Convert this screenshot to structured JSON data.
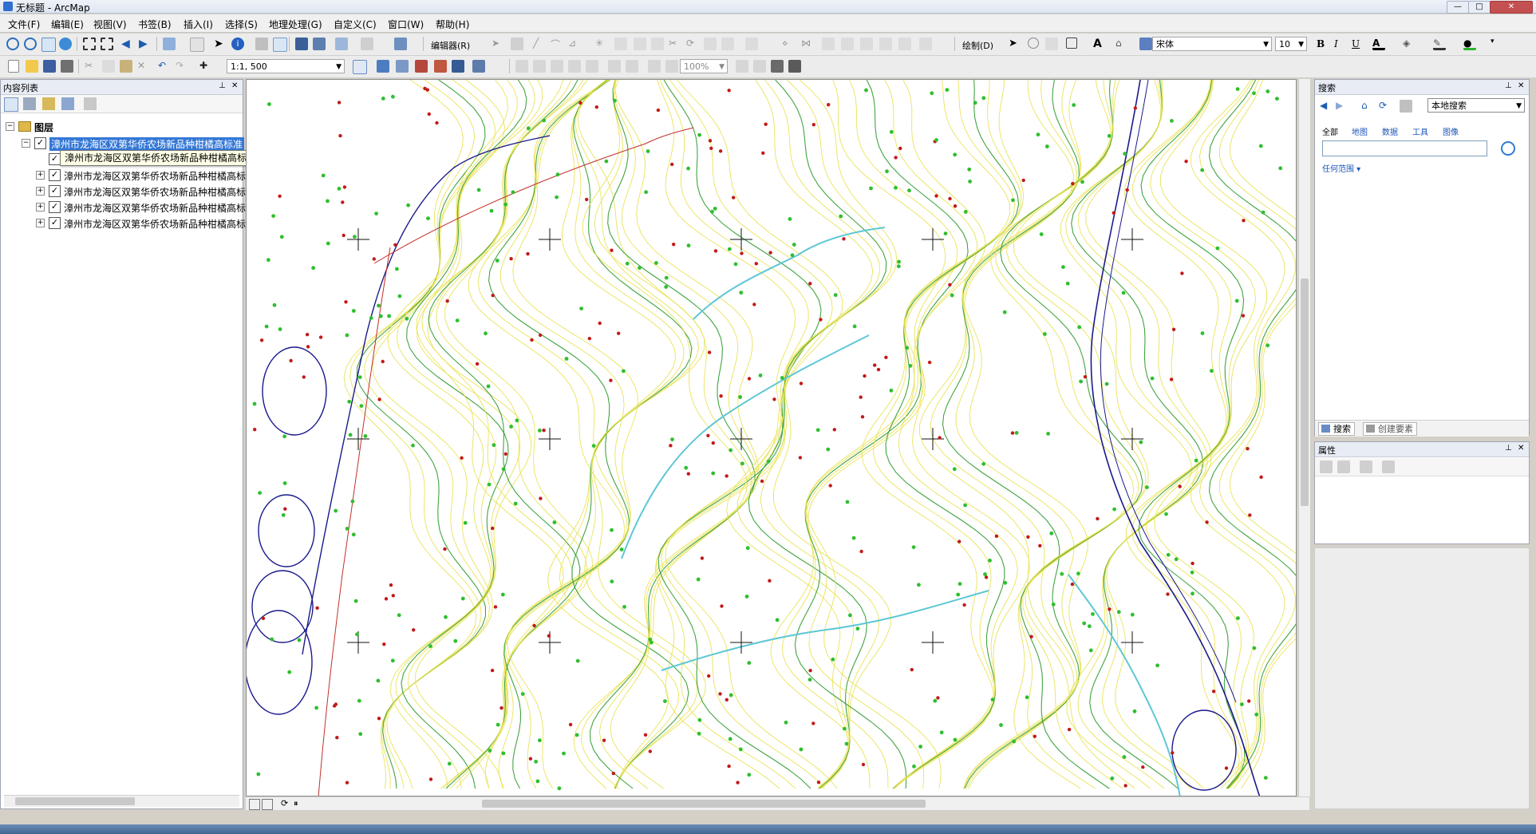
{
  "window": {
    "title": "无标题 - ArcMap",
    "min": "—",
    "max": "□",
    "close": "✕"
  },
  "menu": [
    "文件(F)",
    "编辑(E)",
    "视图(V)",
    "书签(B)",
    "插入(I)",
    "选择(S)",
    "地理处理(G)",
    "自定义(C)",
    "窗口(W)",
    "帮助(H)"
  ],
  "toolbar": {
    "editor_label": "编辑器(R)",
    "draw_label": "绘制(D)",
    "font_name": "宋体",
    "font_size": "10",
    "bold": "B",
    "italic": "I",
    "underline": "U",
    "text_tool": "A",
    "scale": "1:1, 500",
    "zoom_percent": "100%"
  },
  "toc": {
    "title": "内容列表",
    "root_label": "图层",
    "layers": [
      "漳州市龙海区双第华侨农场新品种柑橘高标准",
      "漳州市龙海区双第华侨农场新品种柑橘高标",
      "漳州市龙海区双第华侨农场新品种柑橘高标",
      "漳州市龙海区双第华侨农场新品种柑橘高标",
      "漳州市龙海区双第华侨农场新品种柑橘高标"
    ],
    "tooltip": "漳州市龙海区双第华侨农场新品种柑橘高标准种植示范园（原文件）.dwg Annotation"
  },
  "search": {
    "title": "搜索",
    "scope": "本地搜索",
    "tabs": [
      "全部",
      "地图",
      "数据",
      "工具",
      "图像"
    ],
    "input_value": "",
    "extent_link": "任何范围 ▾",
    "bottom_tabs": [
      "搜索",
      "创建要素"
    ]
  },
  "properties": {
    "title": "属性"
  },
  "colors": {
    "contour_main": "#e8e04a",
    "contour_index": "#2e9a2e",
    "stream": "#5fc7d6",
    "road": "#1a1a8c",
    "boundary": "#c0302a",
    "spot": "#c21a1a",
    "tree_symbol": "#2fbf2f"
  }
}
